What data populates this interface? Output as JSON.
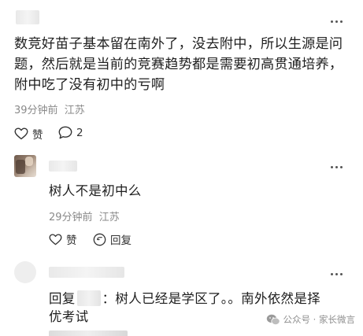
{
  "comment": {
    "text": "数竞好苗子基本留在南外了，没去附中，所以生源是问题，然后就是当前的竞赛趋势都是需要初高贯通培养，附中吃了没有初中的亏啊",
    "time": "39分钟前",
    "location": "江苏",
    "like_label": "赞",
    "reply_count": "2"
  },
  "reply1": {
    "text": "树人不是初中么",
    "time": "29分钟前",
    "location": "江苏",
    "like_label": "赞",
    "reply_label": "回复"
  },
  "reply2": {
    "prefix": "回复",
    "text": "：树人已经是学区了。。南外依然是择优考试"
  },
  "watermark": {
    "text": "公众号 · 家长微言"
  },
  "colors": {
    "text": "#1e1e1e",
    "meta": "#8a8a8a",
    "background": "#ffffff"
  },
  "icons": [
    "more-icon",
    "heart-icon",
    "comment-icon",
    "wechat-icon"
  ]
}
